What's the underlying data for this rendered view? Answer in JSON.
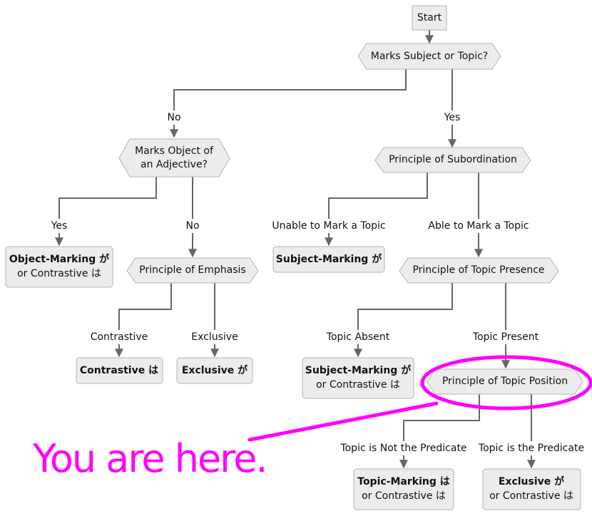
{
  "diagram": {
    "type": "flowchart",
    "nodes": {
      "start": {
        "label": "Start",
        "shape": "rect"
      },
      "q_subject_topic": {
        "label": "Marks Subject or Topic?",
        "shape": "hexagon"
      },
      "q_object_adjective": {
        "line1": "Marks Object of",
        "line2": "an Adjective?",
        "shape": "hexagon"
      },
      "p_subordination": {
        "label": "Principle of Subordination",
        "shape": "hexagon"
      },
      "r_object_marking": {
        "bold": "Object-Marking が",
        "line2": "or Contrastive は",
        "shape": "rounded"
      },
      "p_emphasis": {
        "label": "Principle of Emphasis",
        "shape": "hexagon"
      },
      "r_subject_marking_1": {
        "bold": "Subject-Marking が",
        "shape": "rounded"
      },
      "p_topic_presence": {
        "label": "Principle of Topic Presence",
        "shape": "hexagon"
      },
      "r_contrastive": {
        "bold": "Contrastive は",
        "shape": "rounded"
      },
      "r_exclusive_1": {
        "bold": "Exclusive が",
        "shape": "rounded"
      },
      "r_subject_marking_2": {
        "bold": "Subject-Marking が",
        "line2": "or Contrastive は",
        "shape": "rounded"
      },
      "p_topic_position": {
        "label": "Principle of Topic Position",
        "shape": "hexagon"
      },
      "r_topic_marking": {
        "bold": "Topic-Marking は",
        "line2": "or Contrastive は",
        "shape": "rounded"
      },
      "r_exclusive_2": {
        "bold": "Exclusive が",
        "line2": "or Contrastive は",
        "shape": "rounded"
      }
    },
    "edges": [
      {
        "from": "start",
        "to": "q_subject_topic",
        "label": ""
      },
      {
        "from": "q_subject_topic",
        "to": "q_object_adjective",
        "label": "No"
      },
      {
        "from": "q_subject_topic",
        "to": "p_subordination",
        "label": "Yes"
      },
      {
        "from": "q_object_adjective",
        "to": "r_object_marking",
        "label": "Yes"
      },
      {
        "from": "q_object_adjective",
        "to": "p_emphasis",
        "label": "No"
      },
      {
        "from": "p_subordination",
        "to": "r_subject_marking_1",
        "label": "Unable to Mark a Topic"
      },
      {
        "from": "p_subordination",
        "to": "p_topic_presence",
        "label": "Able to Mark a Topic"
      },
      {
        "from": "p_emphasis",
        "to": "r_contrastive",
        "label": "Contrastive"
      },
      {
        "from": "p_emphasis",
        "to": "r_exclusive_1",
        "label": "Exclusive"
      },
      {
        "from": "p_topic_presence",
        "to": "r_subject_marking_2",
        "label": "Topic Absent"
      },
      {
        "from": "p_topic_presence",
        "to": "p_topic_position",
        "label": "Topic Present"
      },
      {
        "from": "p_topic_position",
        "to": "r_topic_marking",
        "label": "Topic is Not the Predicate"
      },
      {
        "from": "p_topic_position",
        "to": "r_exclusive_2",
        "label": "Topic is the Predicate"
      }
    ],
    "annotation": {
      "text": "You are here.",
      "target": "p_topic_position",
      "color": "#ff00ff"
    },
    "colors": {
      "node_fill": "#ececec",
      "node_stroke": "#b3b3b3",
      "edge": "#666666",
      "highlight": "#ff00ff"
    }
  }
}
